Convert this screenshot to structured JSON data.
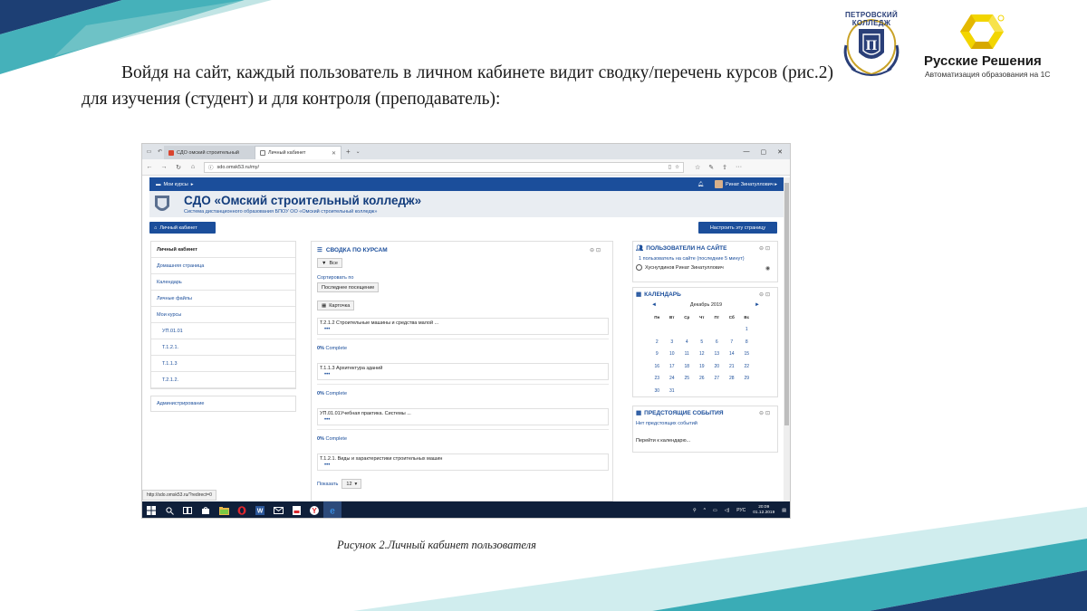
{
  "slide": {
    "paragraph": "Войдя на сайт, каждый пользователь в личном кабинете видит сводку/перечень курсов (рис.2) для изучения (студент) и для контроля (преподаватель):",
    "caption": "Рисунок 2.Личный кабинет пользователя"
  },
  "logos": {
    "college_name": "ПЕТРОВСКИЙ КОЛЛЕДЖ",
    "rr_name": "Русские Решения",
    "rr_sub": "Автоматизация образования на 1С"
  },
  "browser": {
    "tab1": "СДО омский строительный",
    "tab2": "Личный кабинет",
    "url": "sdo.omsk53.ru/my/",
    "status_url": "http://sdo.omsk53.ru/?redirect=0"
  },
  "site": {
    "nav_my_courses": "Мои курсы",
    "user_name": "Ринат Зинатуллович",
    "title": "СДО «Омский строительный колледж»",
    "subtitle": "Система дистанционного образования БПОУ ОО «Омский строительный колледж»",
    "btn_cabinet": "Личный кабинет",
    "btn_customize": "Настроить эту страницу"
  },
  "sidebar": {
    "items": [
      {
        "label": "Личный кабинет"
      },
      {
        "label": "Домашняя страница"
      },
      {
        "label": "Календарь"
      },
      {
        "label": "Личные файлы"
      },
      {
        "label": "Мои курсы"
      },
      {
        "label": "УП.01.01"
      },
      {
        "label": "Т.1.2.1."
      },
      {
        "label": "Т.1.1.3"
      },
      {
        "label": "Т.2.1.2."
      }
    ],
    "admin": "Администрирование"
  },
  "overview": {
    "title": "СВОДКА ПО КУРСАМ",
    "filter": "Все",
    "sort_label": "Сортировать по",
    "sort_value": "Последнее посещение",
    "view_value": "Карточка",
    "courses": [
      {
        "name": "Т.2.1.2 Строительные машины и средства малой ...",
        "percent": "0%",
        "complete": "Complete"
      },
      {
        "name": "Т.1.1.3 Архитектура зданий",
        "percent": "0%",
        "complete": "Complete"
      },
      {
        "name": "УП.01.01Учебная практика. Системы ...",
        "percent": "0%",
        "complete": "Complete"
      },
      {
        "name": "Т.1.2.1. Виды и характеристики строительных машин",
        "percent": "",
        "complete": ""
      }
    ],
    "show_label": "Показать",
    "show_value": "12"
  },
  "users_block": {
    "title": "ПОЛЬЗОВАТЕЛИ НА САЙТЕ",
    "summary": "1 пользователь на сайте (последние 5 минут)",
    "user": "Хуснутдинов Ринат Зинатуллович"
  },
  "calendar": {
    "title": "КАЛЕНДАРЬ",
    "month": "Декабрь 2019",
    "prev": "◄",
    "next": "►",
    "dow": [
      "Пн",
      "Вт",
      "Ср",
      "Чт",
      "Пт",
      "Сб",
      "Вс"
    ],
    "weeks": [
      [
        "",
        "",
        "",
        "",
        "",
        "",
        "1"
      ],
      [
        "2",
        "3",
        "4",
        "5",
        "6",
        "7",
        "8"
      ],
      [
        "9",
        "10",
        "11",
        "12",
        "13",
        "14",
        "15"
      ],
      [
        "16",
        "17",
        "18",
        "19",
        "20",
        "21",
        "22"
      ],
      [
        "23",
        "24",
        "25",
        "26",
        "27",
        "28",
        "29"
      ],
      [
        "30",
        "31",
        "",
        "",
        "",
        "",
        ""
      ]
    ]
  },
  "events_block": {
    "title": "ПРЕДСТОЯЩИЕ СОБЫТИЯ",
    "empty": "Нет предстоящих событий",
    "goto": "Перейти к календарю..."
  },
  "taskbar": {
    "lang": "РУС",
    "time": "20:09",
    "date": "01.12.2019"
  },
  "colors": {
    "moodle_blue": "#1b4e9b",
    "slide_teal": "#1f9aa8",
    "slide_navy": "#1d3f74",
    "rr_yellow": "#f2d500"
  }
}
